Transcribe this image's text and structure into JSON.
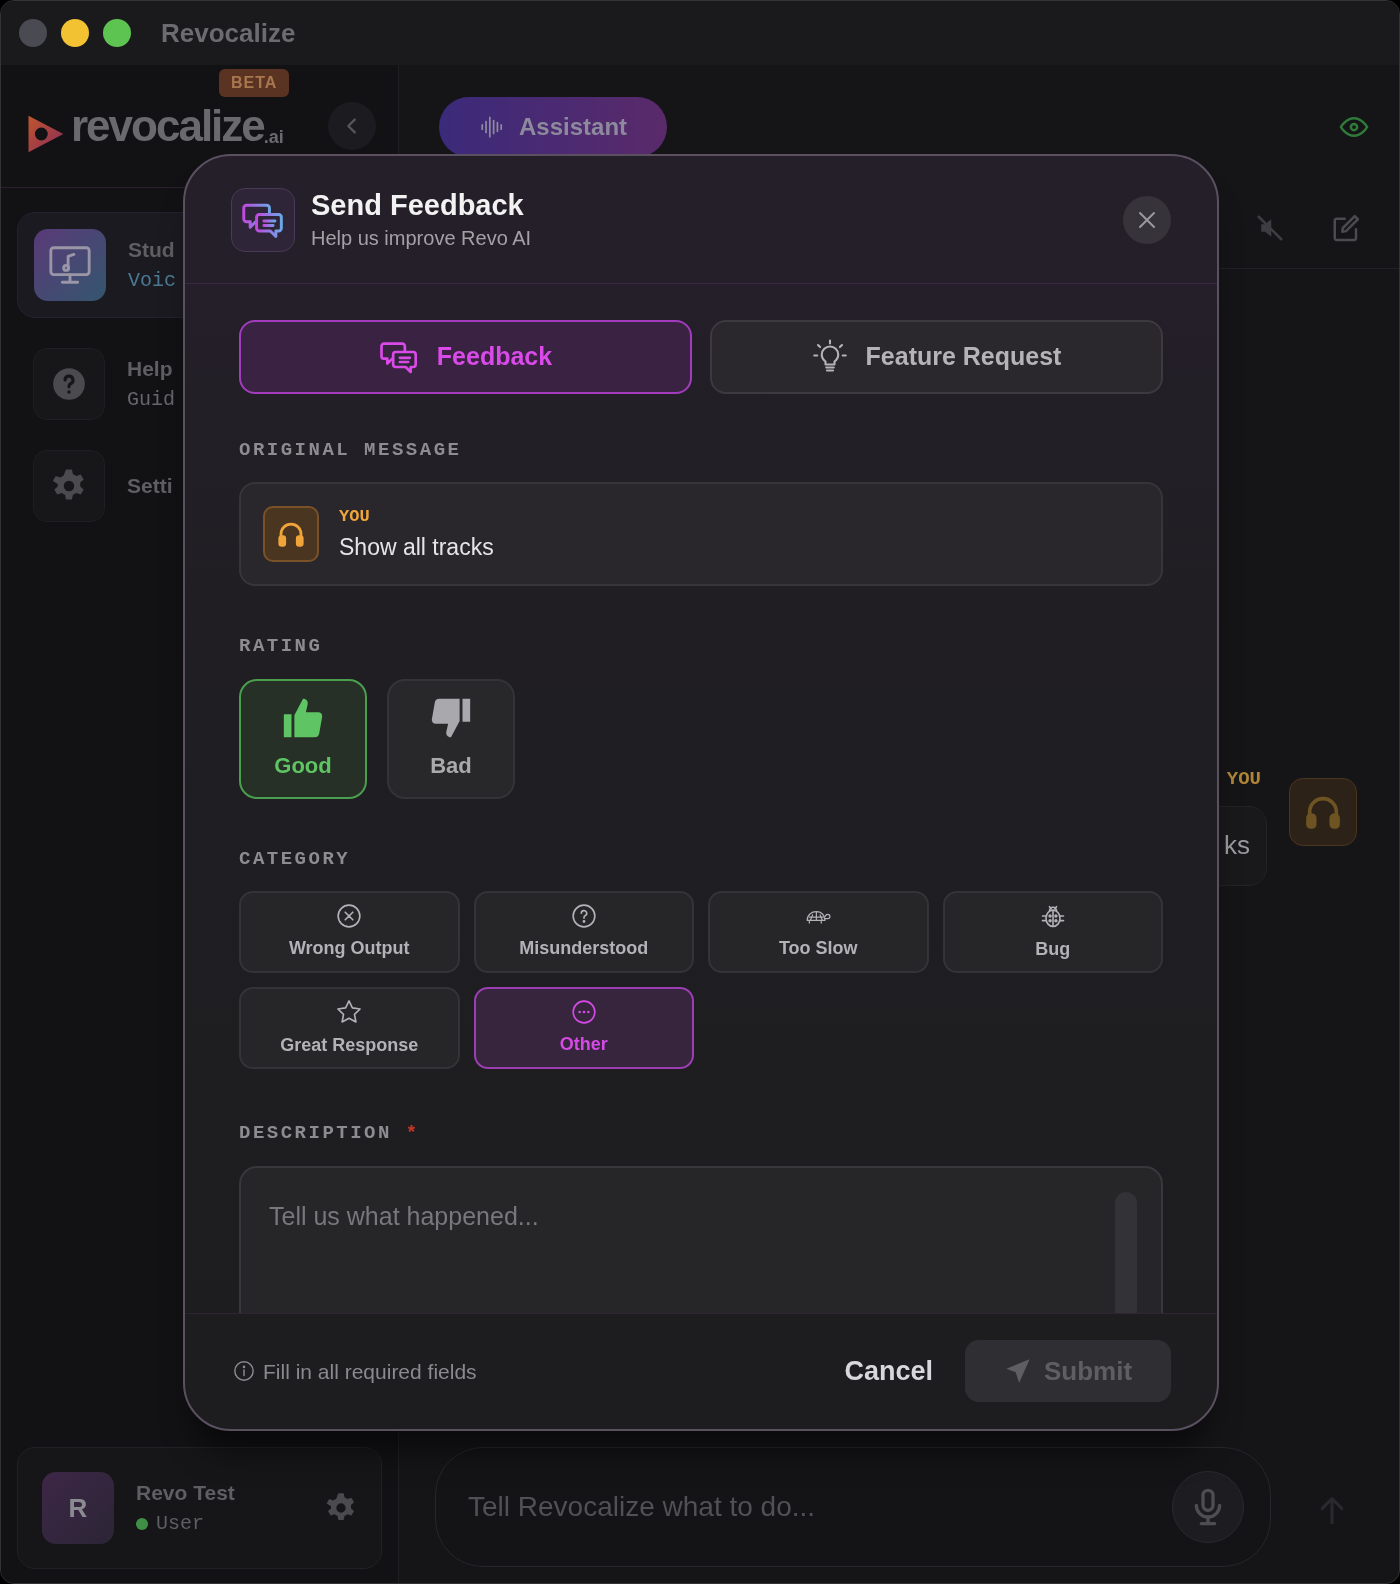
{
  "window": {
    "title": "Revocalize"
  },
  "logo": {
    "name": "revocalize",
    "suffix": ".ai",
    "badge": "BETA"
  },
  "sidebar": {
    "items": [
      {
        "title": "Stud",
        "subtitle": "Voic",
        "kind": "studio",
        "selected": true
      },
      {
        "title": "Help",
        "subtitle": "Guid",
        "kind": "help",
        "selected": false
      },
      {
        "title": "Setti",
        "kind": "settings",
        "selected": false
      }
    ],
    "user": {
      "initial": "R",
      "name": "Revo Test",
      "role": "User",
      "online": true
    }
  },
  "header": {
    "mode_button": "Assistant"
  },
  "chat": {
    "messages": [
      {
        "sender": "YOU",
        "text": "ks"
      }
    ]
  },
  "composer": {
    "placeholder": "Tell Revocalize what to do..."
  },
  "dialog": {
    "title": "Send Feedback",
    "subtitle": "Help us improve Revo AI",
    "tabs": [
      {
        "label": "Feedback",
        "kind": "chat",
        "selected": true
      },
      {
        "label": "Feature Request",
        "kind": "bulb",
        "selected": false
      }
    ],
    "original_message": {
      "heading": "ORIGINAL MESSAGE",
      "sender": "YOU",
      "text": "Show all tracks"
    },
    "rating": {
      "heading": "RATING",
      "options": [
        {
          "label": "Good",
          "kind": "up",
          "selected": true
        },
        {
          "label": "Bad",
          "kind": "down",
          "selected": false
        }
      ]
    },
    "category": {
      "heading": "CATEGORY",
      "options": [
        {
          "label": "Wrong Output",
          "kind": "cross",
          "selected": false
        },
        {
          "label": "Misunderstood",
          "kind": "question",
          "selected": false
        },
        {
          "label": "Too Slow",
          "kind": "turtle",
          "selected": false
        },
        {
          "label": "Bug",
          "kind": "bug",
          "selected": false
        },
        {
          "label": "Great Response",
          "kind": "star",
          "selected": false
        },
        {
          "label": "Other",
          "kind": "dots",
          "selected": true
        }
      ]
    },
    "description": {
      "heading": "DESCRIPTION",
      "required_mark": "*",
      "placeholder": "Tell us what happened..."
    },
    "footer": {
      "hint": "Fill in all required fields",
      "cancel": "Cancel",
      "submit": "Submit",
      "submit_disabled": true
    }
  }
}
